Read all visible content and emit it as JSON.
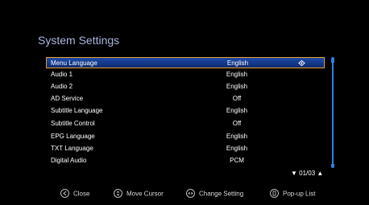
{
  "screen": {
    "title": "System Settings"
  },
  "settings": [
    {
      "label": "Menu Language",
      "value": "English"
    },
    {
      "label": "Audio 1",
      "value": "English"
    },
    {
      "label": "Audio 2",
      "value": "English"
    },
    {
      "label": "AD Service",
      "value": "Off"
    },
    {
      "label": "Subtitle Language",
      "value": "English"
    },
    {
      "label": "Subtitle Control",
      "value": "Off"
    },
    {
      "label": "EPG Language",
      "value": "English"
    },
    {
      "label": "TXT Language",
      "value": "English"
    },
    {
      "label": "Digital Audio",
      "value": "PCM"
    }
  ],
  "pager": {
    "text": "01/03"
  },
  "footer": {
    "close": {
      "label": "Close",
      "icon": "back-icon"
    },
    "move": {
      "label": "Move Cursor",
      "icon": "dpad-updown-icon"
    },
    "change": {
      "label": "Change Setting",
      "icon": "dpad-leftright-icon"
    },
    "popup": {
      "label": "Pop-up List",
      "icon": "ok-icon"
    }
  },
  "colors": {
    "accent_border": "#e6a028",
    "selection": "#1e4aa8",
    "title": "#aab6dd",
    "scrollbar": "#2f7fe0"
  }
}
